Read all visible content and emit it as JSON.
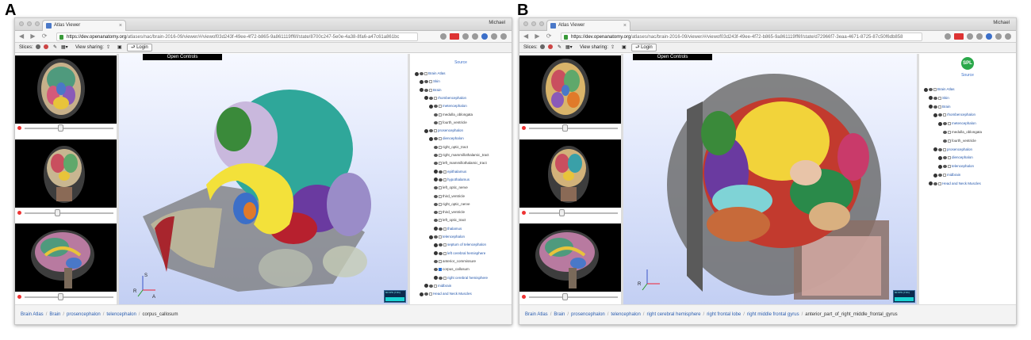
{
  "panel_labels": [
    "A",
    "B"
  ],
  "window": {
    "tab_title": "Atlas Viewer",
    "user": "Michael",
    "toolbar": {
      "slices_label": "Slices:",
      "view_sharing_label": "View sharing:",
      "login_label": "Login"
    },
    "open_controls": "Open Controls",
    "fps_label": "60 FPS (7-61)",
    "tree_title": "Source"
  },
  "panel_a": {
    "url_domain": "https://dev.openanatomy.org",
    "url_path": "/atlases/nac/brain-2016-09/viewer/#/viewof03d243f-49ee-4f72-b865-9a861119ff6f/state/8700c247-5e0e-4a38-8fa6-a47c61a861bc",
    "breadcrumb": [
      "Brain Atlas",
      "Brain",
      "prosencephalon",
      "telencephalon",
      "corpus_callosum"
    ],
    "tree": [
      {
        "label": "Brain Atlas",
        "d": 0,
        "leaf": false
      },
      {
        "label": "Skin",
        "d": 1,
        "leaf": false
      },
      {
        "label": "Brain",
        "d": 1,
        "leaf": false
      },
      {
        "label": "rhombencephalon",
        "d": 2,
        "leaf": false
      },
      {
        "label": "metencephalon",
        "d": 3,
        "leaf": false
      },
      {
        "label": "medulla_oblongata",
        "d": 4,
        "leaf": true
      },
      {
        "label": "fourth_ventricle",
        "d": 4,
        "leaf": true
      },
      {
        "label": "prosencephalon",
        "d": 2,
        "leaf": false
      },
      {
        "label": "diencephalon",
        "d": 3,
        "leaf": false
      },
      {
        "label": "right_optic_tract",
        "d": 4,
        "leaf": true
      },
      {
        "label": "right_mammillothalamic_tract",
        "d": 4,
        "leaf": true
      },
      {
        "label": "left_mammillothalamic_tract",
        "d": 4,
        "leaf": true
      },
      {
        "label": "epithalamus",
        "d": 4,
        "leaf": false
      },
      {
        "label": "hypothalamus",
        "d": 4,
        "leaf": false
      },
      {
        "label": "left_optic_nerve",
        "d": 4,
        "leaf": true
      },
      {
        "label": "third_ventricle",
        "d": 4,
        "leaf": true
      },
      {
        "label": "right_optic_nerve",
        "d": 4,
        "leaf": true
      },
      {
        "label": "third_ventricle",
        "d": 4,
        "leaf": true
      },
      {
        "label": "left_optic_tract",
        "d": 4,
        "leaf": true
      },
      {
        "label": "thalamus",
        "d": 4,
        "leaf": false
      },
      {
        "label": "telencephalon",
        "d": 3,
        "leaf": false
      },
      {
        "label": "septum of telencephalon",
        "d": 4,
        "leaf": false
      },
      {
        "label": "left cerebral hemisphere",
        "d": 4,
        "leaf": false
      },
      {
        "label": "anterior_commissure",
        "d": 4,
        "leaf": true
      },
      {
        "label": "corpus_callosum",
        "d": 4,
        "leaf": true,
        "checked": true
      },
      {
        "label": "right cerebral hemisphere",
        "d": 4,
        "leaf": false
      },
      {
        "label": "midbrain",
        "d": 2,
        "leaf": false
      },
      {
        "label": "Head and Neck Muscles",
        "d": 1,
        "leaf": false
      }
    ]
  },
  "panel_b": {
    "url_domain": "https://dev.openanatomy.org",
    "url_path": "/atlases/nac/brain-2016-09/viewer/#/viewof03d243f-49ee-4f72-b865-9a861119ff6f/state/d72966f7-3eaa-4671-8725-87c50f6db858",
    "logo_text": "SPL",
    "breadcrumb": [
      "Brain Atlas",
      "Brain",
      "prosencephalon",
      "telencephalon",
      "right cerebral hemisphere",
      "right frontal lobe",
      "right middle frontal gyrus",
      "anterior_part_of_right_middle_frontal_gyrus"
    ],
    "tree": [
      {
        "label": "Brain Atlas",
        "d": 0,
        "leaf": false
      },
      {
        "label": "Skin",
        "d": 1,
        "leaf": false
      },
      {
        "label": "Brain",
        "d": 1,
        "leaf": false
      },
      {
        "label": "rhombencephalon",
        "d": 2,
        "leaf": false
      },
      {
        "label": "metencephalon",
        "d": 3,
        "leaf": false
      },
      {
        "label": "medulla_oblongata",
        "d": 4,
        "leaf": true
      },
      {
        "label": "fourth_ventricle",
        "d": 4,
        "leaf": true
      },
      {
        "label": "prosencephalon",
        "d": 2,
        "leaf": false
      },
      {
        "label": "diencephalon",
        "d": 3,
        "leaf": false
      },
      {
        "label": "telencephalon",
        "d": 3,
        "leaf": false
      },
      {
        "label": "midbrain",
        "d": 2,
        "leaf": false
      },
      {
        "label": "Head and Neck Muscles",
        "d": 1,
        "leaf": false
      }
    ]
  }
}
